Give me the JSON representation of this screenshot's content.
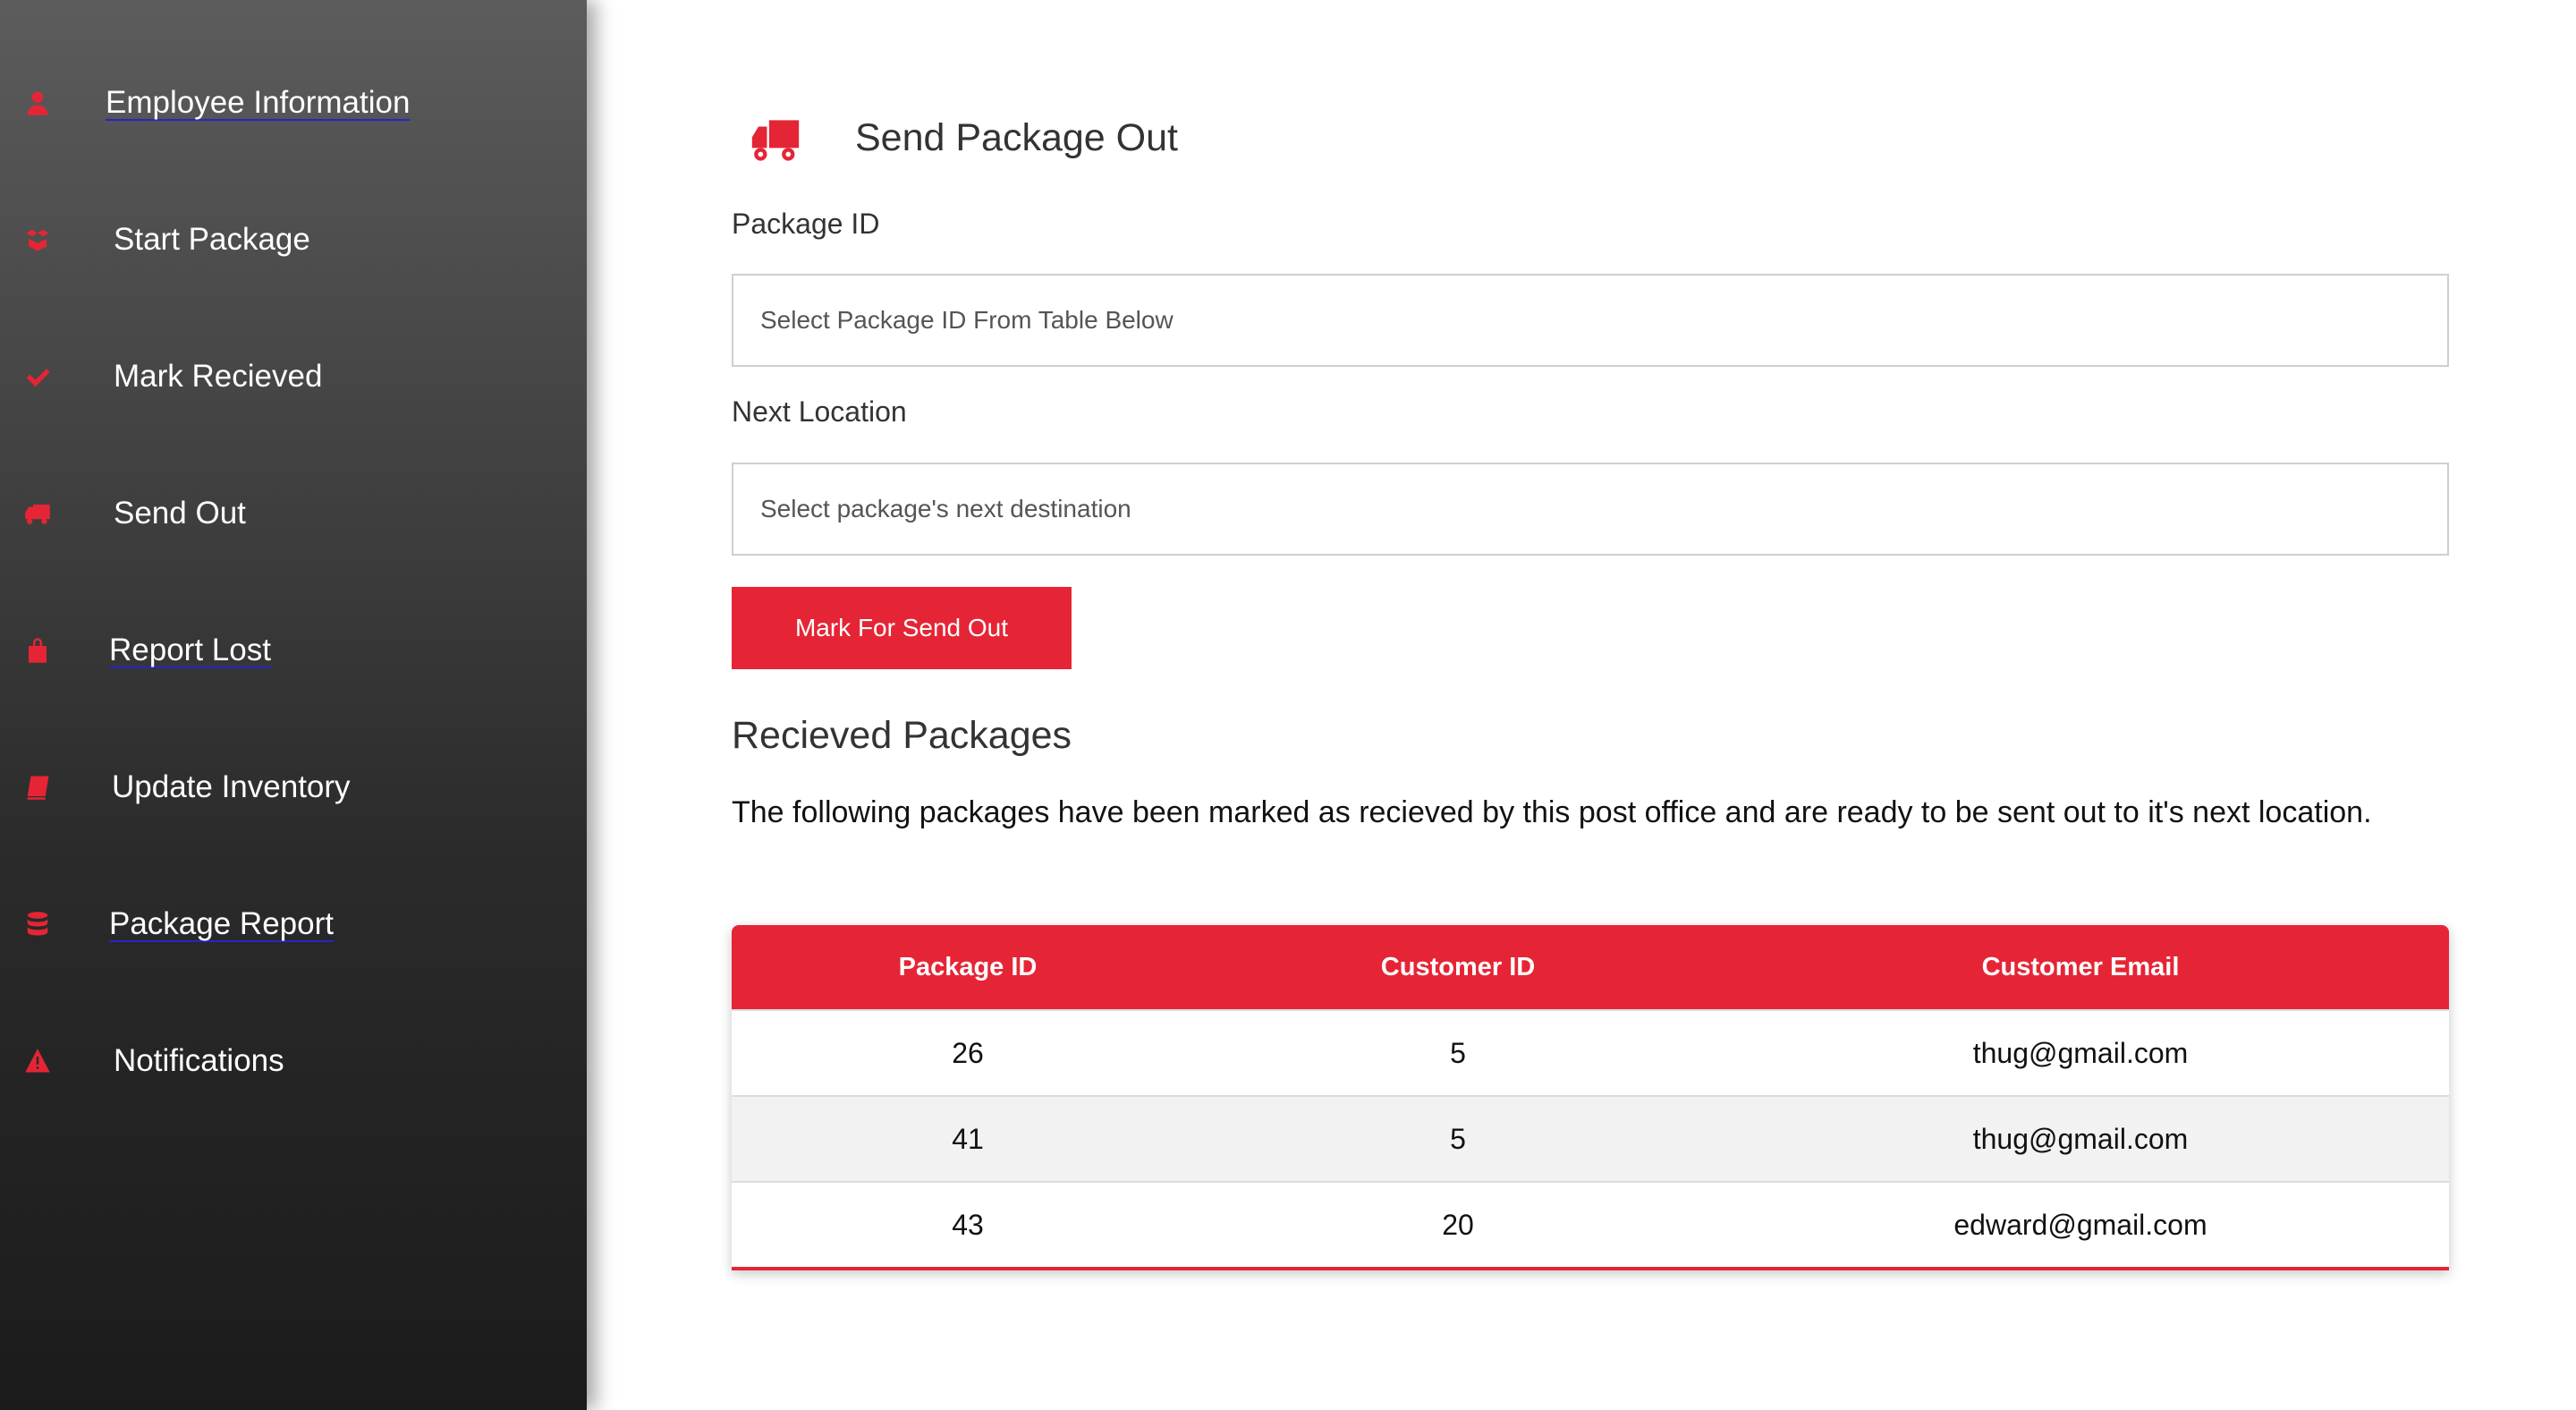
{
  "sidebar": {
    "items": [
      {
        "label": "Employee Information",
        "icon": "user-icon"
      },
      {
        "label": "Start Package",
        "icon": "box-open-icon"
      },
      {
        "label": "Mark Recieved",
        "icon": "check-icon"
      },
      {
        "label": "Send Out",
        "icon": "truck-icon"
      },
      {
        "label": "Report Lost",
        "icon": "lost-item-icon"
      },
      {
        "label": "Update Inventory",
        "icon": "book-icon"
      },
      {
        "label": "Package Report",
        "icon": "database-icon"
      },
      {
        "label": "Notifications",
        "icon": "warning-icon"
      }
    ]
  },
  "main": {
    "title": "Send Package Out",
    "title_icon": "truck-icon",
    "package_id_label": "Package ID",
    "package_id_placeholder": "Select Package ID From Table Below",
    "next_location_label": "Next Location",
    "next_location_placeholder": "Select package's next destination",
    "submit_label": "Mark For Send Out",
    "section_title": "Recieved Packages",
    "description": "The following packages have been marked as recieved by this post office and are ready to be sent out to it's next location."
  },
  "table": {
    "headers": [
      "Package ID",
      "Customer ID",
      "Customer Email"
    ],
    "rows": [
      [
        "26",
        "5",
        "thug@gmail.com"
      ],
      [
        "41",
        "5",
        "thug@gmail.com"
      ],
      [
        "43",
        "20",
        "edward@gmail.com"
      ]
    ]
  },
  "colors": {
    "accent": "#e52535",
    "sidebar_top": "#5c5c5c",
    "sidebar_bottom": "#1b1b1b",
    "link_underline": "#2525c8"
  }
}
